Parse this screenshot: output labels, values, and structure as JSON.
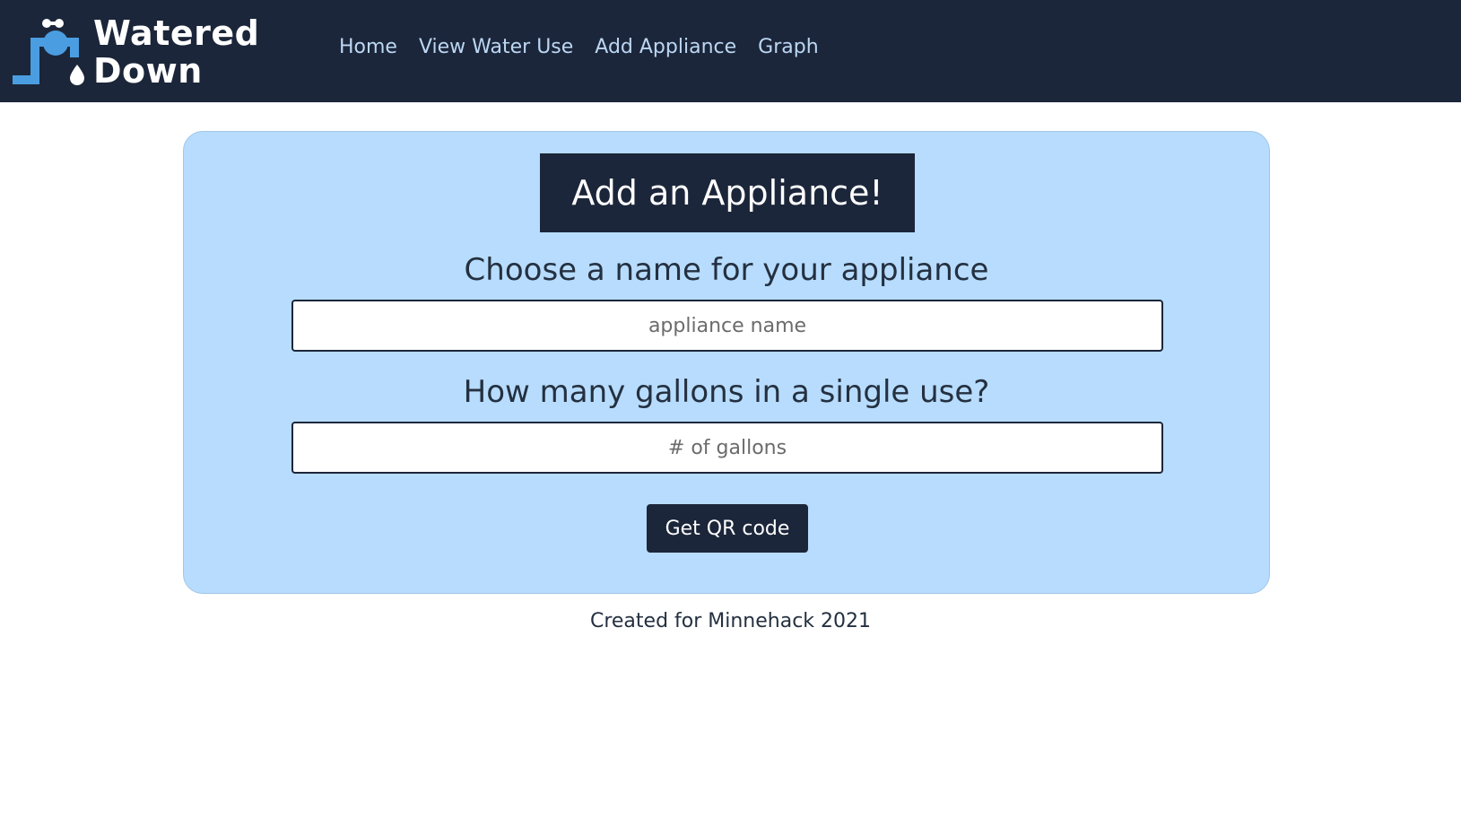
{
  "brand": {
    "line1": "Watered",
    "line2": "Down",
    "logo_icon": "faucet-droplet-icon"
  },
  "nav": {
    "items": [
      {
        "label": "Home"
      },
      {
        "label": "View Water Use"
      },
      {
        "label": "Add Appliance"
      },
      {
        "label": "Graph"
      }
    ]
  },
  "form": {
    "title": "Add an Appliance!",
    "name_label": "Choose a name for your appliance",
    "name_placeholder": "appliance name",
    "name_value": "",
    "gallons_label": "How many gallons in a single use?",
    "gallons_placeholder": "# of gallons",
    "gallons_value": "",
    "submit_label": "Get QR code"
  },
  "footer": {
    "text": "Created for Minnehack 2021"
  },
  "colors": {
    "navbar": "#1c263a",
    "card": "#b7dcfd",
    "nav_link": "#bcd7f3",
    "logo_blue": "#4a9de0"
  }
}
